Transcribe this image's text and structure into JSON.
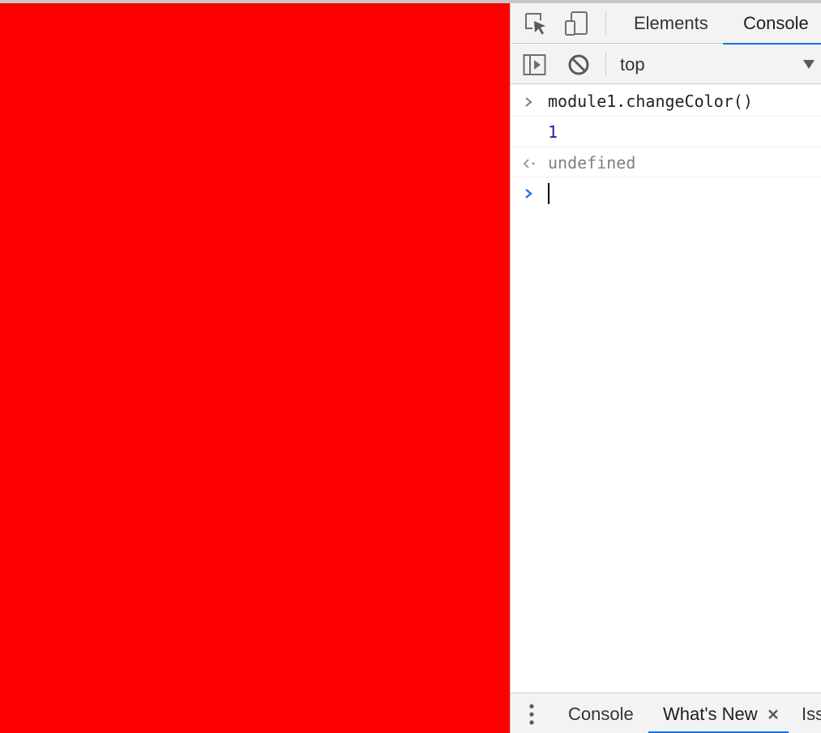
{
  "page": {
    "background_color": "#ff0000"
  },
  "devtools": {
    "tabs": [
      {
        "label": "Elements",
        "active": false
      },
      {
        "label": "Console",
        "active": true
      }
    ],
    "toolbar": {
      "context": "top",
      "icons": [
        "inspect-element-icon",
        "device-toolbar-icon",
        "sidebar-toggle-icon",
        "clear-console-icon",
        "dropdown-arrow-icon"
      ]
    },
    "console": {
      "entries": [
        {
          "kind": "input",
          "text": "module1.changeColor()"
        },
        {
          "kind": "log",
          "text": "1"
        },
        {
          "kind": "result",
          "text": "undefined"
        }
      ],
      "prompt_text": ""
    },
    "drawer": {
      "tabs": [
        {
          "label": "Console",
          "active": false
        },
        {
          "label": "What's New",
          "active": true,
          "closable": true
        },
        {
          "label": "Iss",
          "active": false
        }
      ]
    },
    "colors": {
      "accent": "#1a73e8",
      "number": "#1a1aa6",
      "muted": "#808080"
    }
  }
}
